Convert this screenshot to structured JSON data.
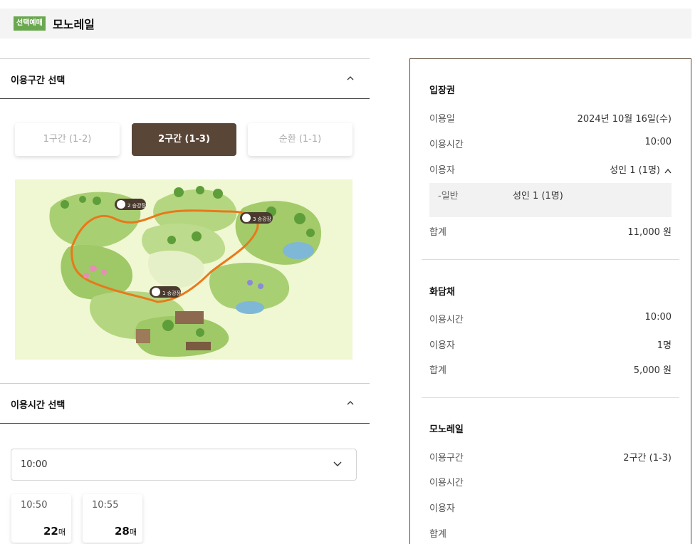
{
  "header": {
    "badge": "선택예매",
    "title": "모노레일"
  },
  "route_section": {
    "label": "이용구간 선택",
    "options": [
      "1구간 (1-2)",
      "2구간 (1-3)",
      "순환 (1-1)"
    ],
    "selected": "2구간 (1-3)",
    "map_labels": {
      "station1": "1 승강장",
      "station2": "2 승강장",
      "station3": "3 승강장"
    }
  },
  "time_section": {
    "label": "이용시간 선택",
    "selected_value": "10:00",
    "slots": [
      {
        "time": "10:50",
        "count": "22",
        "unit": "매"
      },
      {
        "time": "10:55",
        "count": "28",
        "unit": "매"
      }
    ]
  },
  "summary": {
    "ticket": {
      "title": "입장권",
      "date_label": "이용일",
      "date_value": "2024년 10월 16일(수)",
      "time_label": "이용시간",
      "time_value": "10:00",
      "user_label": "이용자",
      "user_value": "성인 1 (1명)",
      "detail_type": "-일반",
      "detail_value": "성인 1 (1명)",
      "total_label": "합계",
      "total_value": "11,000 원"
    },
    "hwadamchae": {
      "title": "화담채",
      "time_label": "이용시간",
      "time_value": "10:00",
      "user_label": "이용자",
      "user_value": "1명",
      "total_label": "합계",
      "total_value": "5,000 원"
    },
    "monorail": {
      "title": "모노레일",
      "route_label": "이용구간",
      "route_value": "2구간 (1-3)",
      "time_label": "이용시간",
      "user_label": "이용자",
      "total_label": "합계"
    }
  },
  "colors": {
    "accent": "#5a4637",
    "badge": "#6aa84f",
    "route_line": "#e8791a",
    "map_bg": "#f0f7d3"
  }
}
